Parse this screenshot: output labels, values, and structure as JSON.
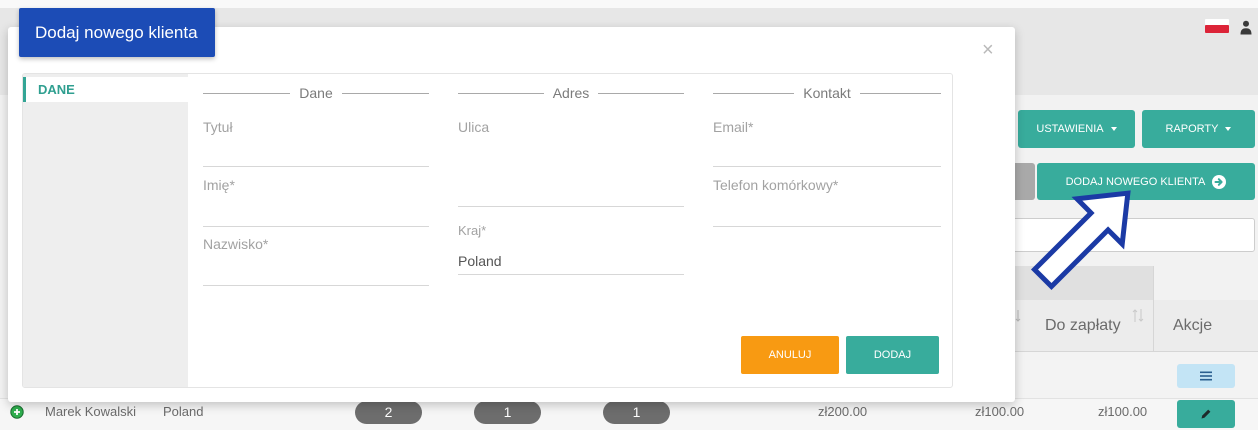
{
  "header": {
    "icons": [
      "poland-flag-icon",
      "user-icon"
    ]
  },
  "toolbar": {
    "settings": "USTAWIENIA",
    "reports": "RAPORTY",
    "add_client": "DODAJ NOWEGO KLIENTA",
    "icons": [
      "caret-down-icon",
      "arrow-circle-right-icon"
    ]
  },
  "search": {
    "value": ""
  },
  "table": {
    "columns": {
      "to_pay": "Do zapłaty",
      "actions": "Akcje"
    },
    "icons": [
      "sort-icon",
      "list-icon",
      "edit-pencil-icon",
      "expand-plus-icon"
    ],
    "rows": [
      {
        "name": "Marek Kowalski",
        "country": "Poland",
        "counts": [
          "2",
          "1",
          "1"
        ],
        "amounts": [
          "zł200.00",
          "zł100.00",
          "zł100.00"
        ]
      }
    ]
  },
  "modal": {
    "title": "Dodaj nowego klienta",
    "close_label": "×",
    "tabs": [
      {
        "label": "DANE",
        "active": true
      }
    ],
    "sections": [
      {
        "legend": "Dane",
        "fields": [
          {
            "label": "Tytuł",
            "value": ""
          },
          {
            "label": "Imię*",
            "value": ""
          },
          {
            "label": "Nazwisko*",
            "value": ""
          }
        ]
      },
      {
        "legend": "Adres",
        "fields": [
          {
            "label": "Ulica",
            "value": ""
          },
          {
            "label": "Kraj*",
            "value": "Poland"
          }
        ]
      },
      {
        "legend": "Kontakt",
        "fields": [
          {
            "label": "Email*",
            "value": ""
          },
          {
            "label": "Telefon komórkowy*",
            "value": ""
          }
        ]
      }
    ],
    "buttons": {
      "cancel": "ANULUJ",
      "submit": "DODAJ"
    }
  },
  "colors": {
    "teal": "#38ac9c",
    "modal_title_blue": "#1c4cb6",
    "cancel_orange": "#f89a12",
    "annotation_arrow": "#1b3aa5",
    "count_badge": "#6d6d6d",
    "list_button": "#c3e4f5"
  }
}
